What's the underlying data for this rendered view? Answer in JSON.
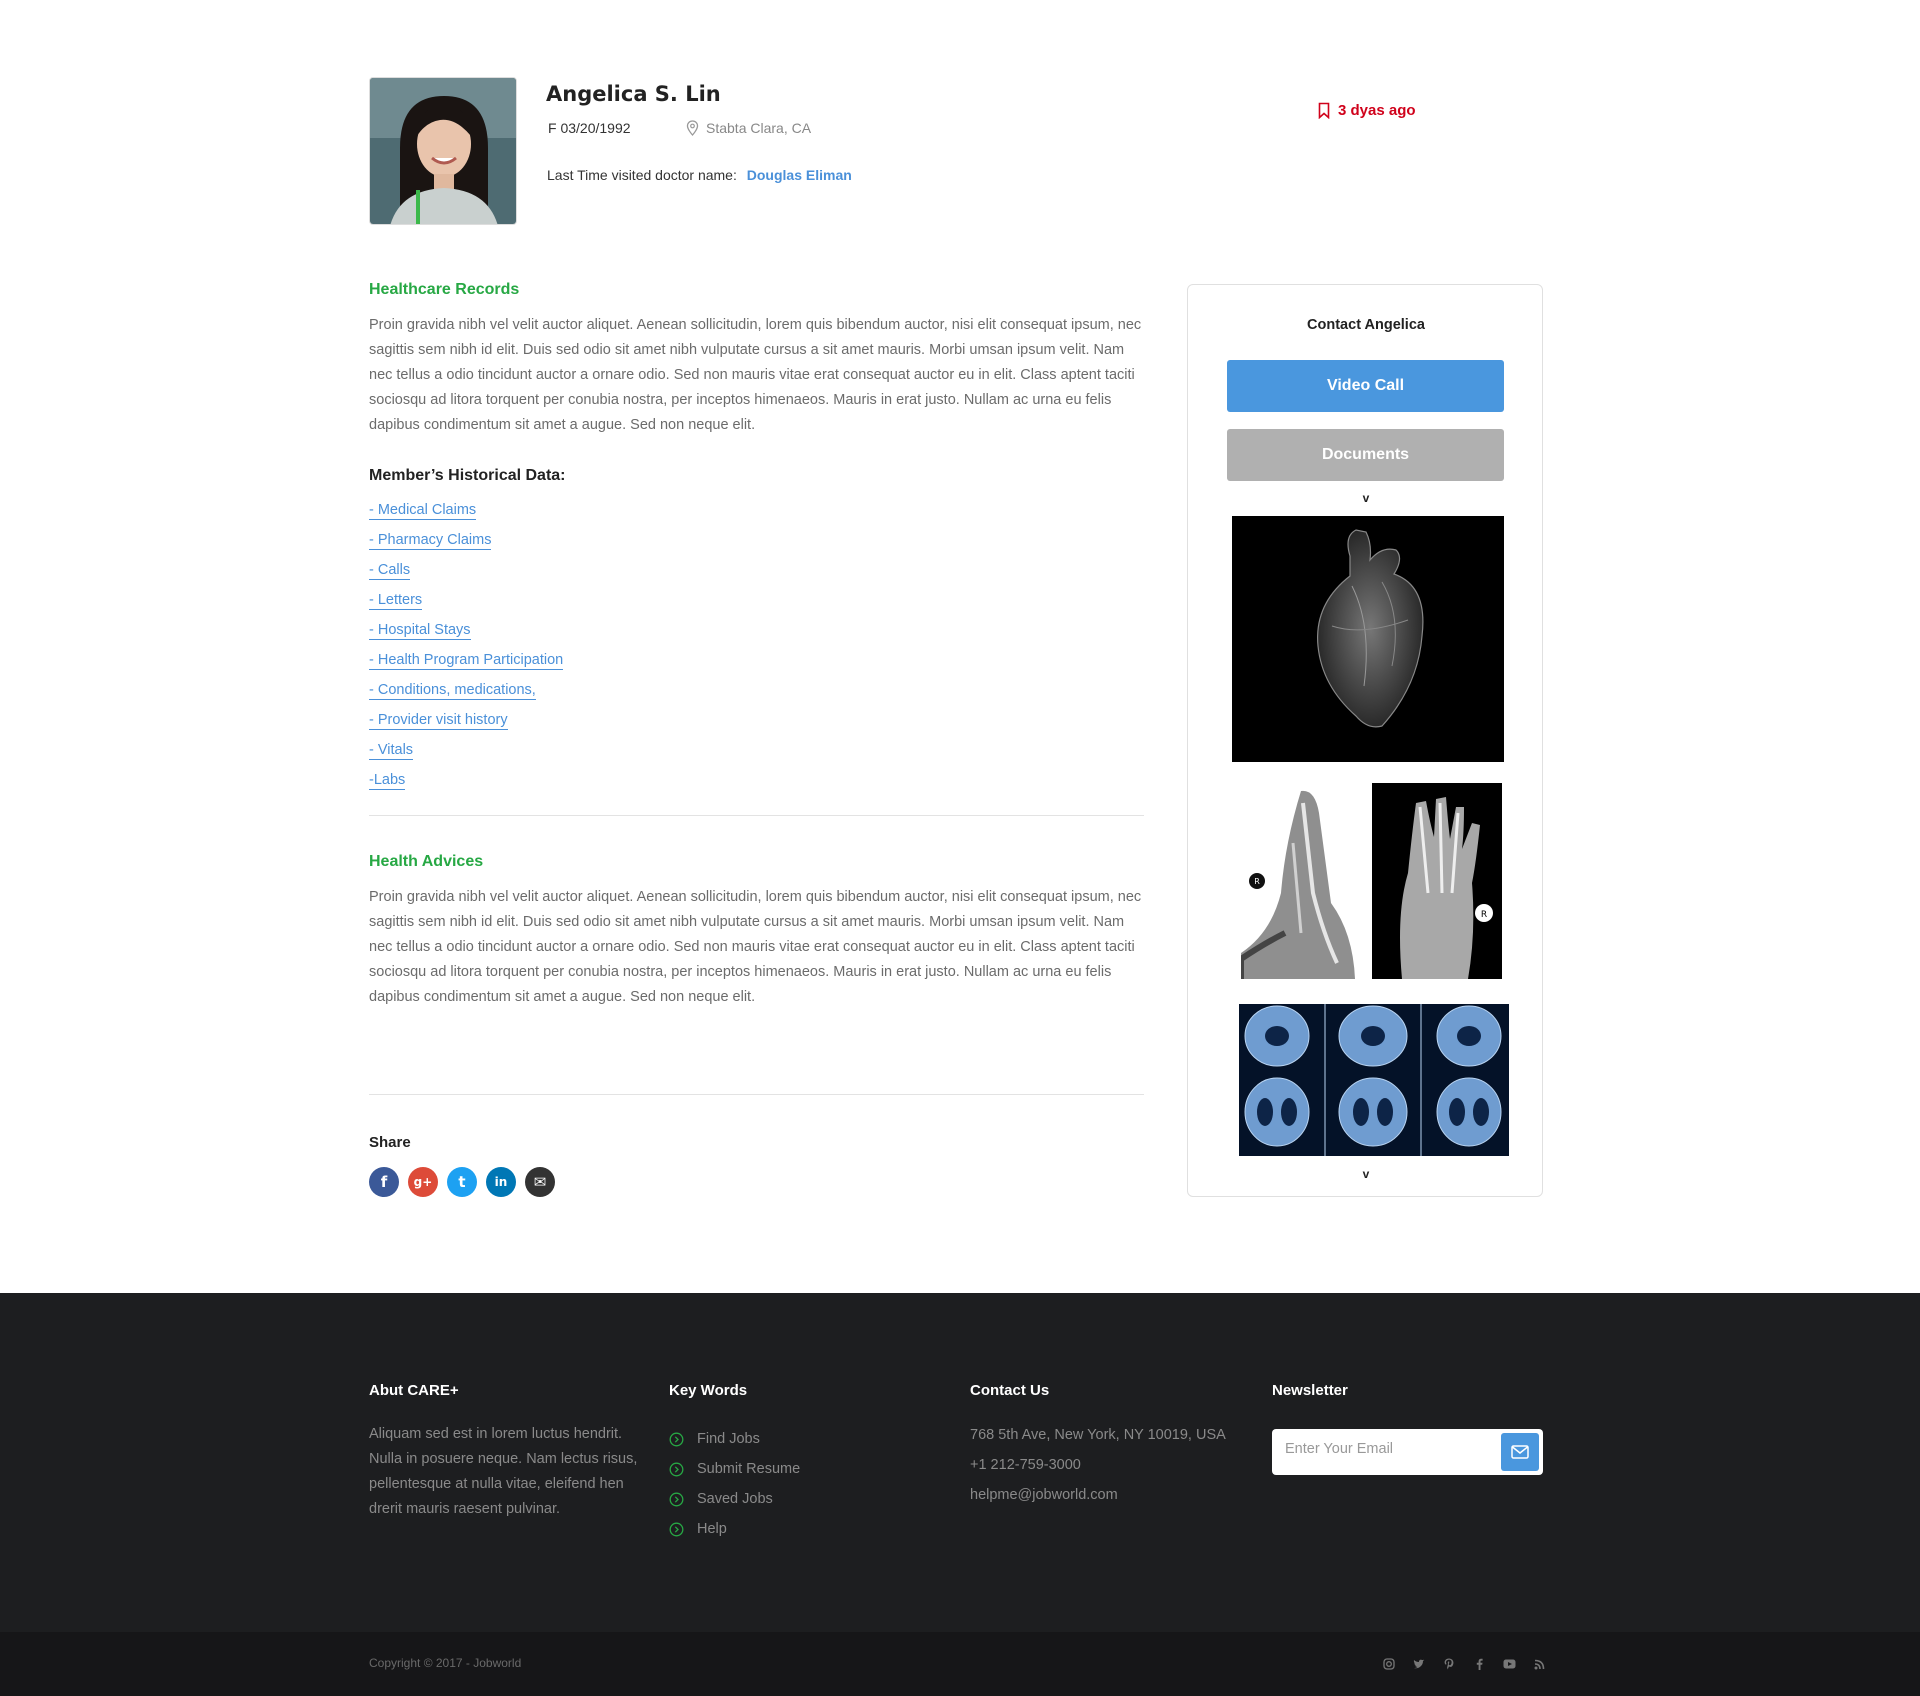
{
  "profile": {
    "name": "Angelica S. Lin",
    "dob": "F 03/20/1992",
    "location": "Stabta Clara, CA",
    "last_visit_label": "Last Time visited doctor name:",
    "doctor_name": "Douglas Eliman",
    "posted_ago": "3 dyas ago"
  },
  "records": {
    "title": "Healthcare Records",
    "body": "Proin gravida nibh vel velit auctor aliquet. Aenean sollicitudin, lorem quis bibendum auctor, nisi elit consequat ipsum, nec sagittis sem nibh id elit. Duis sed odio sit amet nibh vulputate cursus a sit amet mauris. Morbi umsan ipsum velit. Nam nec tellus a odio tincidunt auctor a ornare odio. Sed non  mauris vitae erat consequat auctor eu in elit. Class aptent taciti sociosqu ad litora torquent per conubia nostra, per inceptos himenaeos. Mauris in erat justo. Nullam ac urna eu felis dapibus condimentum sit amet a augue. Sed non neque elit."
  },
  "history": {
    "title": "Member’s Historical Data:",
    "items": [
      "- Medical Claims",
      "- Pharmacy Claims",
      "- Calls",
      "- Letters",
      "- Hospital Stays",
      "- Health Program Participation",
      "- Conditions, medications, ",
      "- Provider visit history",
      "- Vitals",
      "-Labs"
    ]
  },
  "advices": {
    "title": "Health Advices",
    "body": "Proin gravida nibh vel velit auctor aliquet. Aenean sollicitudin, lorem quis bibendum auctor, nisi elit consequat ipsum, nec sagittis sem nibh id elit. Duis sed odio sit amet nibh vulputate cursus a sit amet mauris. Morbi umsan ipsum velit. Nam nec tellus a odio tincidunt auctor a ornare odio. Sed non  mauris vitae erat consequat auctor eu in elit. Class aptent taciti sociosqu ad litora torquent per conubia nostra, per inceptos himenaeos. Mauris in erat justo. Nullam ac urna eu felis dapibus condimentum sit amet a augue. Sed non neque elit."
  },
  "share": {
    "label": "Share",
    "buttons": [
      {
        "name": "facebook",
        "glyph": "f",
        "color": "#3b5998"
      },
      {
        "name": "google-plus",
        "glyph": "g+",
        "color": "#dd4b39"
      },
      {
        "name": "twitter",
        "glyph": "t",
        "color": "#1da1f2"
      },
      {
        "name": "linkedin",
        "glyph": "in",
        "color": "#0077b5"
      },
      {
        "name": "email",
        "glyph": "✉",
        "color": "#333333"
      }
    ]
  },
  "contact_card": {
    "title": "Contact Angelica",
    "video_call": "Video Call",
    "documents": "Documents",
    "chevron": "v"
  },
  "footer": {
    "about_title": "Abut CARE+",
    "about_text": "Aliquam sed est in lorem luctus hendrit. Nulla in posuere neque. Nam lectus risus, pellentesque at nulla vitae, eleifend hen drerit mauris raesent pulvinar.",
    "keywords_title": "Key Words",
    "keywords": [
      "Find Jobs",
      "Submit Resume",
      "Saved Jobs",
      "Help"
    ],
    "contact_title": "Contact Us",
    "address": "768 5th Ave, New York, NY 10019, USA",
    "phone": "+1 212-759-3000",
    "email": "helpme@jobworld.com",
    "newsletter_title": "Newsletter",
    "newsletter_placeholder": "Enter Your Email",
    "copyright": "Copyright © 2017 - Jobworld",
    "social_icons": [
      "instagram-icon",
      "twitter-icon",
      "pinterest-icon",
      "facebook-icon",
      "youtube-icon",
      "rss-icon"
    ]
  },
  "colors": {
    "accent_green": "#27a844",
    "link_blue": "#4a90d9",
    "alert_red": "#d0021b",
    "footer_bg": "#1d1e20"
  }
}
